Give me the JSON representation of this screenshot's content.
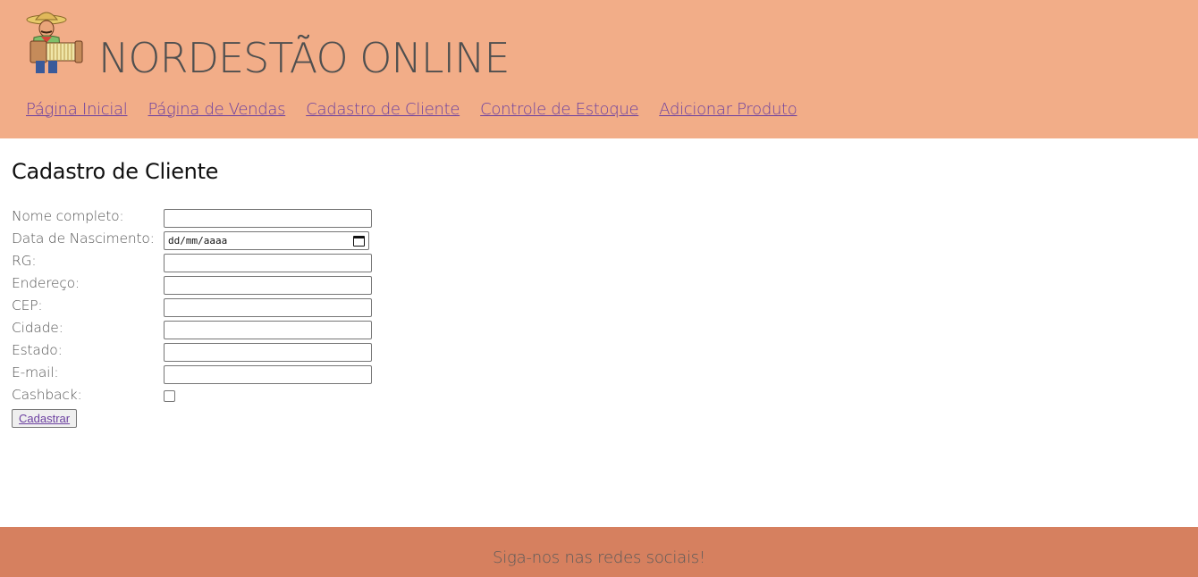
{
  "header": {
    "title": "NORDESTÃO ONLINE",
    "nav": [
      "Página Inicial",
      "Página de Vendas",
      "Cadastro de Cliente",
      "Controle de Estoque",
      "Adicionar Produto"
    ]
  },
  "main": {
    "heading": "Cadastro de Cliente",
    "fields": {
      "nome": "Nome completo:",
      "nascimento": "Data de Nascimento:",
      "nascimento_placeholder": "dd/mm/aaaa",
      "rg": "RG:",
      "endereco": "Endereço:",
      "cep": "CEP:",
      "cidade": "Cidade:",
      "estado": "Estado:",
      "email": "E-mail:",
      "cashback": "Cashback:"
    },
    "submit_label": "Cadastrar"
  },
  "footer": {
    "text": "Siga-nos nas redes sociais!"
  },
  "colors": {
    "header_bg": "#f2ad88",
    "footer_bg": "#d6805f",
    "link": "#6b3fa0"
  }
}
